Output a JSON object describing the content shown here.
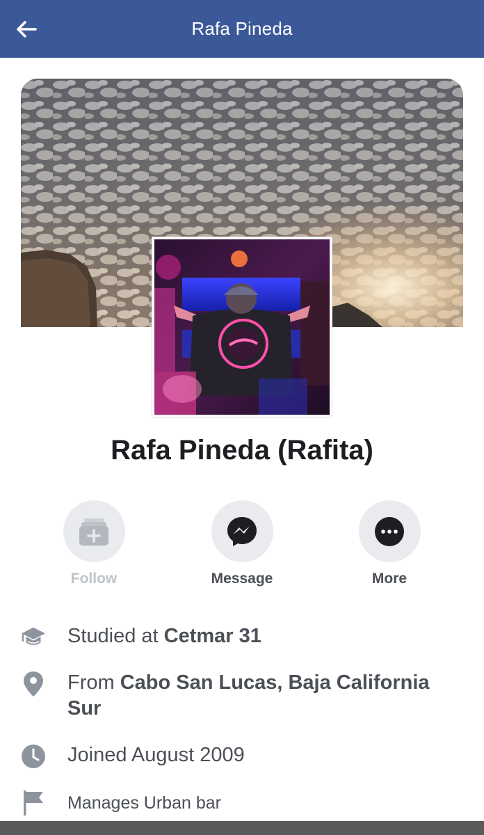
{
  "header": {
    "title": "Rafa Pineda",
    "background": "#3b5998"
  },
  "profile": {
    "display_name": "Rafa Pineda (Rafita)"
  },
  "actions": [
    {
      "label": "Follow",
      "icon": "follow-icon",
      "enabled": false
    },
    {
      "label": "Message",
      "icon": "messenger-icon",
      "enabled": true
    },
    {
      "label": "More",
      "icon": "more-icon",
      "enabled": true
    }
  ],
  "info": {
    "education": {
      "prefix": "Studied at ",
      "value": "Cetmar 31",
      "icon": "graduation-cap-icon"
    },
    "hometown": {
      "prefix": "From ",
      "value": "Cabo San Lucas, Baja California Sur",
      "icon": "location-pin-icon"
    },
    "joined": {
      "text": "Joined August 2009",
      "icon": "clock-icon"
    },
    "manages": {
      "text": "Manages Urban bar",
      "icon": "flag-icon"
    }
  }
}
